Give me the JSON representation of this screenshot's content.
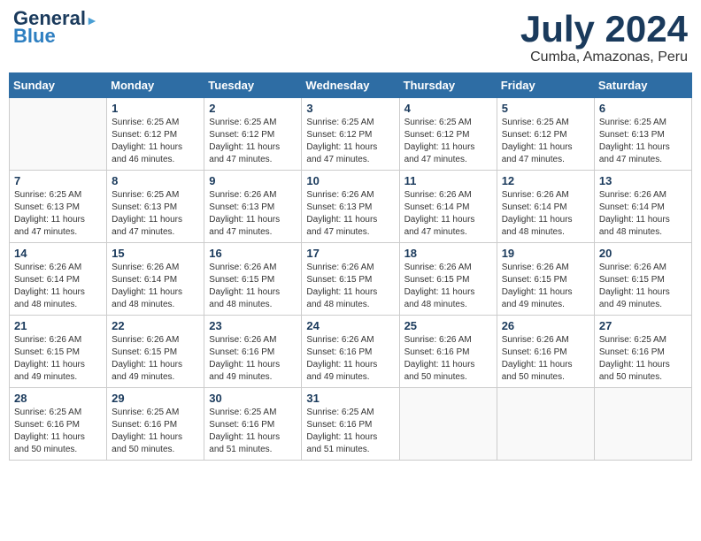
{
  "header": {
    "logo_line1": "General",
    "logo_line2": "Blue",
    "month_year": "July 2024",
    "location": "Cumba, Amazonas, Peru"
  },
  "days_of_week": [
    "Sunday",
    "Monday",
    "Tuesday",
    "Wednesday",
    "Thursday",
    "Friday",
    "Saturday"
  ],
  "weeks": [
    [
      {
        "day": "",
        "info": ""
      },
      {
        "day": "1",
        "info": "Sunrise: 6:25 AM\nSunset: 6:12 PM\nDaylight: 11 hours\nand 46 minutes."
      },
      {
        "day": "2",
        "info": "Sunrise: 6:25 AM\nSunset: 6:12 PM\nDaylight: 11 hours\nand 47 minutes."
      },
      {
        "day": "3",
        "info": "Sunrise: 6:25 AM\nSunset: 6:12 PM\nDaylight: 11 hours\nand 47 minutes."
      },
      {
        "day": "4",
        "info": "Sunrise: 6:25 AM\nSunset: 6:12 PM\nDaylight: 11 hours\nand 47 minutes."
      },
      {
        "day": "5",
        "info": "Sunrise: 6:25 AM\nSunset: 6:12 PM\nDaylight: 11 hours\nand 47 minutes."
      },
      {
        "day": "6",
        "info": "Sunrise: 6:25 AM\nSunset: 6:13 PM\nDaylight: 11 hours\nand 47 minutes."
      }
    ],
    [
      {
        "day": "7",
        "info": "Sunrise: 6:25 AM\nSunset: 6:13 PM\nDaylight: 11 hours\nand 47 minutes."
      },
      {
        "day": "8",
        "info": "Sunrise: 6:25 AM\nSunset: 6:13 PM\nDaylight: 11 hours\nand 47 minutes."
      },
      {
        "day": "9",
        "info": "Sunrise: 6:26 AM\nSunset: 6:13 PM\nDaylight: 11 hours\nand 47 minutes."
      },
      {
        "day": "10",
        "info": "Sunrise: 6:26 AM\nSunset: 6:13 PM\nDaylight: 11 hours\nand 47 minutes."
      },
      {
        "day": "11",
        "info": "Sunrise: 6:26 AM\nSunset: 6:14 PM\nDaylight: 11 hours\nand 47 minutes."
      },
      {
        "day": "12",
        "info": "Sunrise: 6:26 AM\nSunset: 6:14 PM\nDaylight: 11 hours\nand 48 minutes."
      },
      {
        "day": "13",
        "info": "Sunrise: 6:26 AM\nSunset: 6:14 PM\nDaylight: 11 hours\nand 48 minutes."
      }
    ],
    [
      {
        "day": "14",
        "info": "Sunrise: 6:26 AM\nSunset: 6:14 PM\nDaylight: 11 hours\nand 48 minutes."
      },
      {
        "day": "15",
        "info": "Sunrise: 6:26 AM\nSunset: 6:14 PM\nDaylight: 11 hours\nand 48 minutes."
      },
      {
        "day": "16",
        "info": "Sunrise: 6:26 AM\nSunset: 6:15 PM\nDaylight: 11 hours\nand 48 minutes."
      },
      {
        "day": "17",
        "info": "Sunrise: 6:26 AM\nSunset: 6:15 PM\nDaylight: 11 hours\nand 48 minutes."
      },
      {
        "day": "18",
        "info": "Sunrise: 6:26 AM\nSunset: 6:15 PM\nDaylight: 11 hours\nand 48 minutes."
      },
      {
        "day": "19",
        "info": "Sunrise: 6:26 AM\nSunset: 6:15 PM\nDaylight: 11 hours\nand 49 minutes."
      },
      {
        "day": "20",
        "info": "Sunrise: 6:26 AM\nSunset: 6:15 PM\nDaylight: 11 hours\nand 49 minutes."
      }
    ],
    [
      {
        "day": "21",
        "info": "Sunrise: 6:26 AM\nSunset: 6:15 PM\nDaylight: 11 hours\nand 49 minutes."
      },
      {
        "day": "22",
        "info": "Sunrise: 6:26 AM\nSunset: 6:15 PM\nDaylight: 11 hours\nand 49 minutes."
      },
      {
        "day": "23",
        "info": "Sunrise: 6:26 AM\nSunset: 6:16 PM\nDaylight: 11 hours\nand 49 minutes."
      },
      {
        "day": "24",
        "info": "Sunrise: 6:26 AM\nSunset: 6:16 PM\nDaylight: 11 hours\nand 49 minutes."
      },
      {
        "day": "25",
        "info": "Sunrise: 6:26 AM\nSunset: 6:16 PM\nDaylight: 11 hours\nand 50 minutes."
      },
      {
        "day": "26",
        "info": "Sunrise: 6:26 AM\nSunset: 6:16 PM\nDaylight: 11 hours\nand 50 minutes."
      },
      {
        "day": "27",
        "info": "Sunrise: 6:25 AM\nSunset: 6:16 PM\nDaylight: 11 hours\nand 50 minutes."
      }
    ],
    [
      {
        "day": "28",
        "info": "Sunrise: 6:25 AM\nSunset: 6:16 PM\nDaylight: 11 hours\nand 50 minutes."
      },
      {
        "day": "29",
        "info": "Sunrise: 6:25 AM\nSunset: 6:16 PM\nDaylight: 11 hours\nand 50 minutes."
      },
      {
        "day": "30",
        "info": "Sunrise: 6:25 AM\nSunset: 6:16 PM\nDaylight: 11 hours\nand 51 minutes."
      },
      {
        "day": "31",
        "info": "Sunrise: 6:25 AM\nSunset: 6:16 PM\nDaylight: 11 hours\nand 51 minutes."
      },
      {
        "day": "",
        "info": ""
      },
      {
        "day": "",
        "info": ""
      },
      {
        "day": "",
        "info": ""
      }
    ]
  ]
}
